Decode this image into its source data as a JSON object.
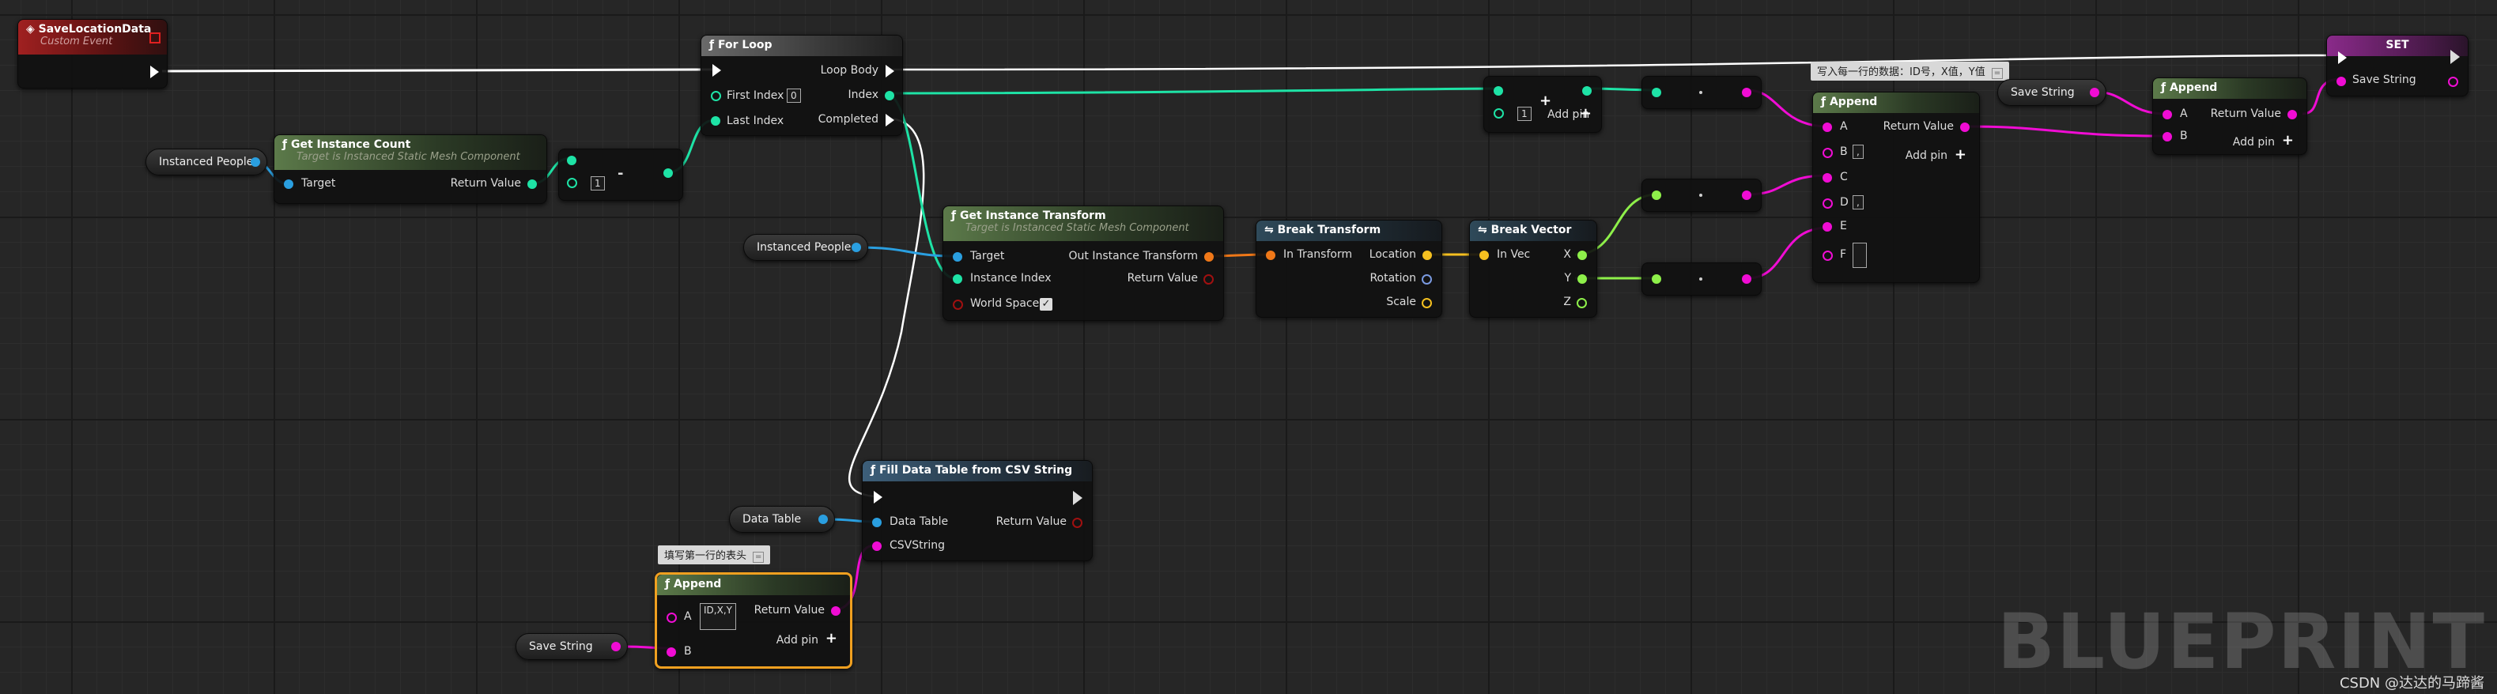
{
  "event": {
    "title": "SaveLocationData",
    "subtitle": "Custom Event"
  },
  "for_loop": {
    "title": "For Loop",
    "first_index": "First Index",
    "first_index_value": "0",
    "last_index": "Last Index",
    "loop_body": "Loop Body",
    "index": "Index",
    "completed": "Completed"
  },
  "get_instance_count": {
    "title": "Get Instance Count",
    "subtitle": "Target is Instanced Static Mesh Component",
    "target": "Target",
    "return_value": "Return Value"
  },
  "subtract": {
    "operator": "-",
    "value": "1"
  },
  "instanced_people_1": "Instanced People",
  "instanced_people_2": "Instanced People",
  "add_node": {
    "value": "1",
    "add_pin": "Add pin"
  },
  "get_instance_transform": {
    "title": "Get Instance Transform",
    "subtitle": "Target is Instanced Static Mesh Component",
    "target": "Target",
    "instance_index": "Instance Index",
    "world_space": "World Space",
    "out_transform": "Out Instance Transform",
    "return_value": "Return Value"
  },
  "break_transform": {
    "title": "Break Transform",
    "in_transform": "In Transform",
    "location": "Location",
    "rotation": "Rotation",
    "scale": "Scale"
  },
  "break_vector": {
    "title": "Break Vector",
    "in_vec": "In Vec",
    "x": "X",
    "y": "Y",
    "z": "Z"
  },
  "append_main": {
    "title": "Append",
    "comment": "写入每一行的数据：ID号，X值，Y值",
    "a": "A",
    "b": "B",
    "b_value": ",",
    "c": "C",
    "d": "D",
    "d_value": ",",
    "e": "E",
    "f": "F",
    "return_value": "Return Value",
    "add_pin": "Add pin"
  },
  "save_string_top": "Save String",
  "append_top": {
    "title": "Append",
    "a": "A",
    "b": "B",
    "return_value": "Return Value",
    "add_pin": "Add pin"
  },
  "set_node": {
    "title": "SET",
    "save_string": "Save String"
  },
  "fill_table": {
    "title": "Fill Data Table from CSV String",
    "data_table": "Data Table",
    "csv_string": "CSVString",
    "return_value": "Return Value"
  },
  "data_table_var": "Data Table",
  "append_bottom": {
    "title": "Append",
    "comment": "填写第一行的表头",
    "a": "A",
    "a_value": "ID,X,Y",
    "b": "B",
    "return_value": "Return Value",
    "add_pin": "Add pin"
  },
  "save_string_bottom": "Save String",
  "watermark": "BLUEPRINT",
  "credit": "CSDN @达达的马蹄酱",
  "colors": {
    "exec": "#ffffff",
    "int": "#1ee3a6",
    "object": "#2a9fe0",
    "string": "#f00cd4",
    "transform": "#f07818",
    "vector": "#f5c020",
    "float": "#8ef04a",
    "bool": "#a01010",
    "struct": "#e0a000"
  }
}
